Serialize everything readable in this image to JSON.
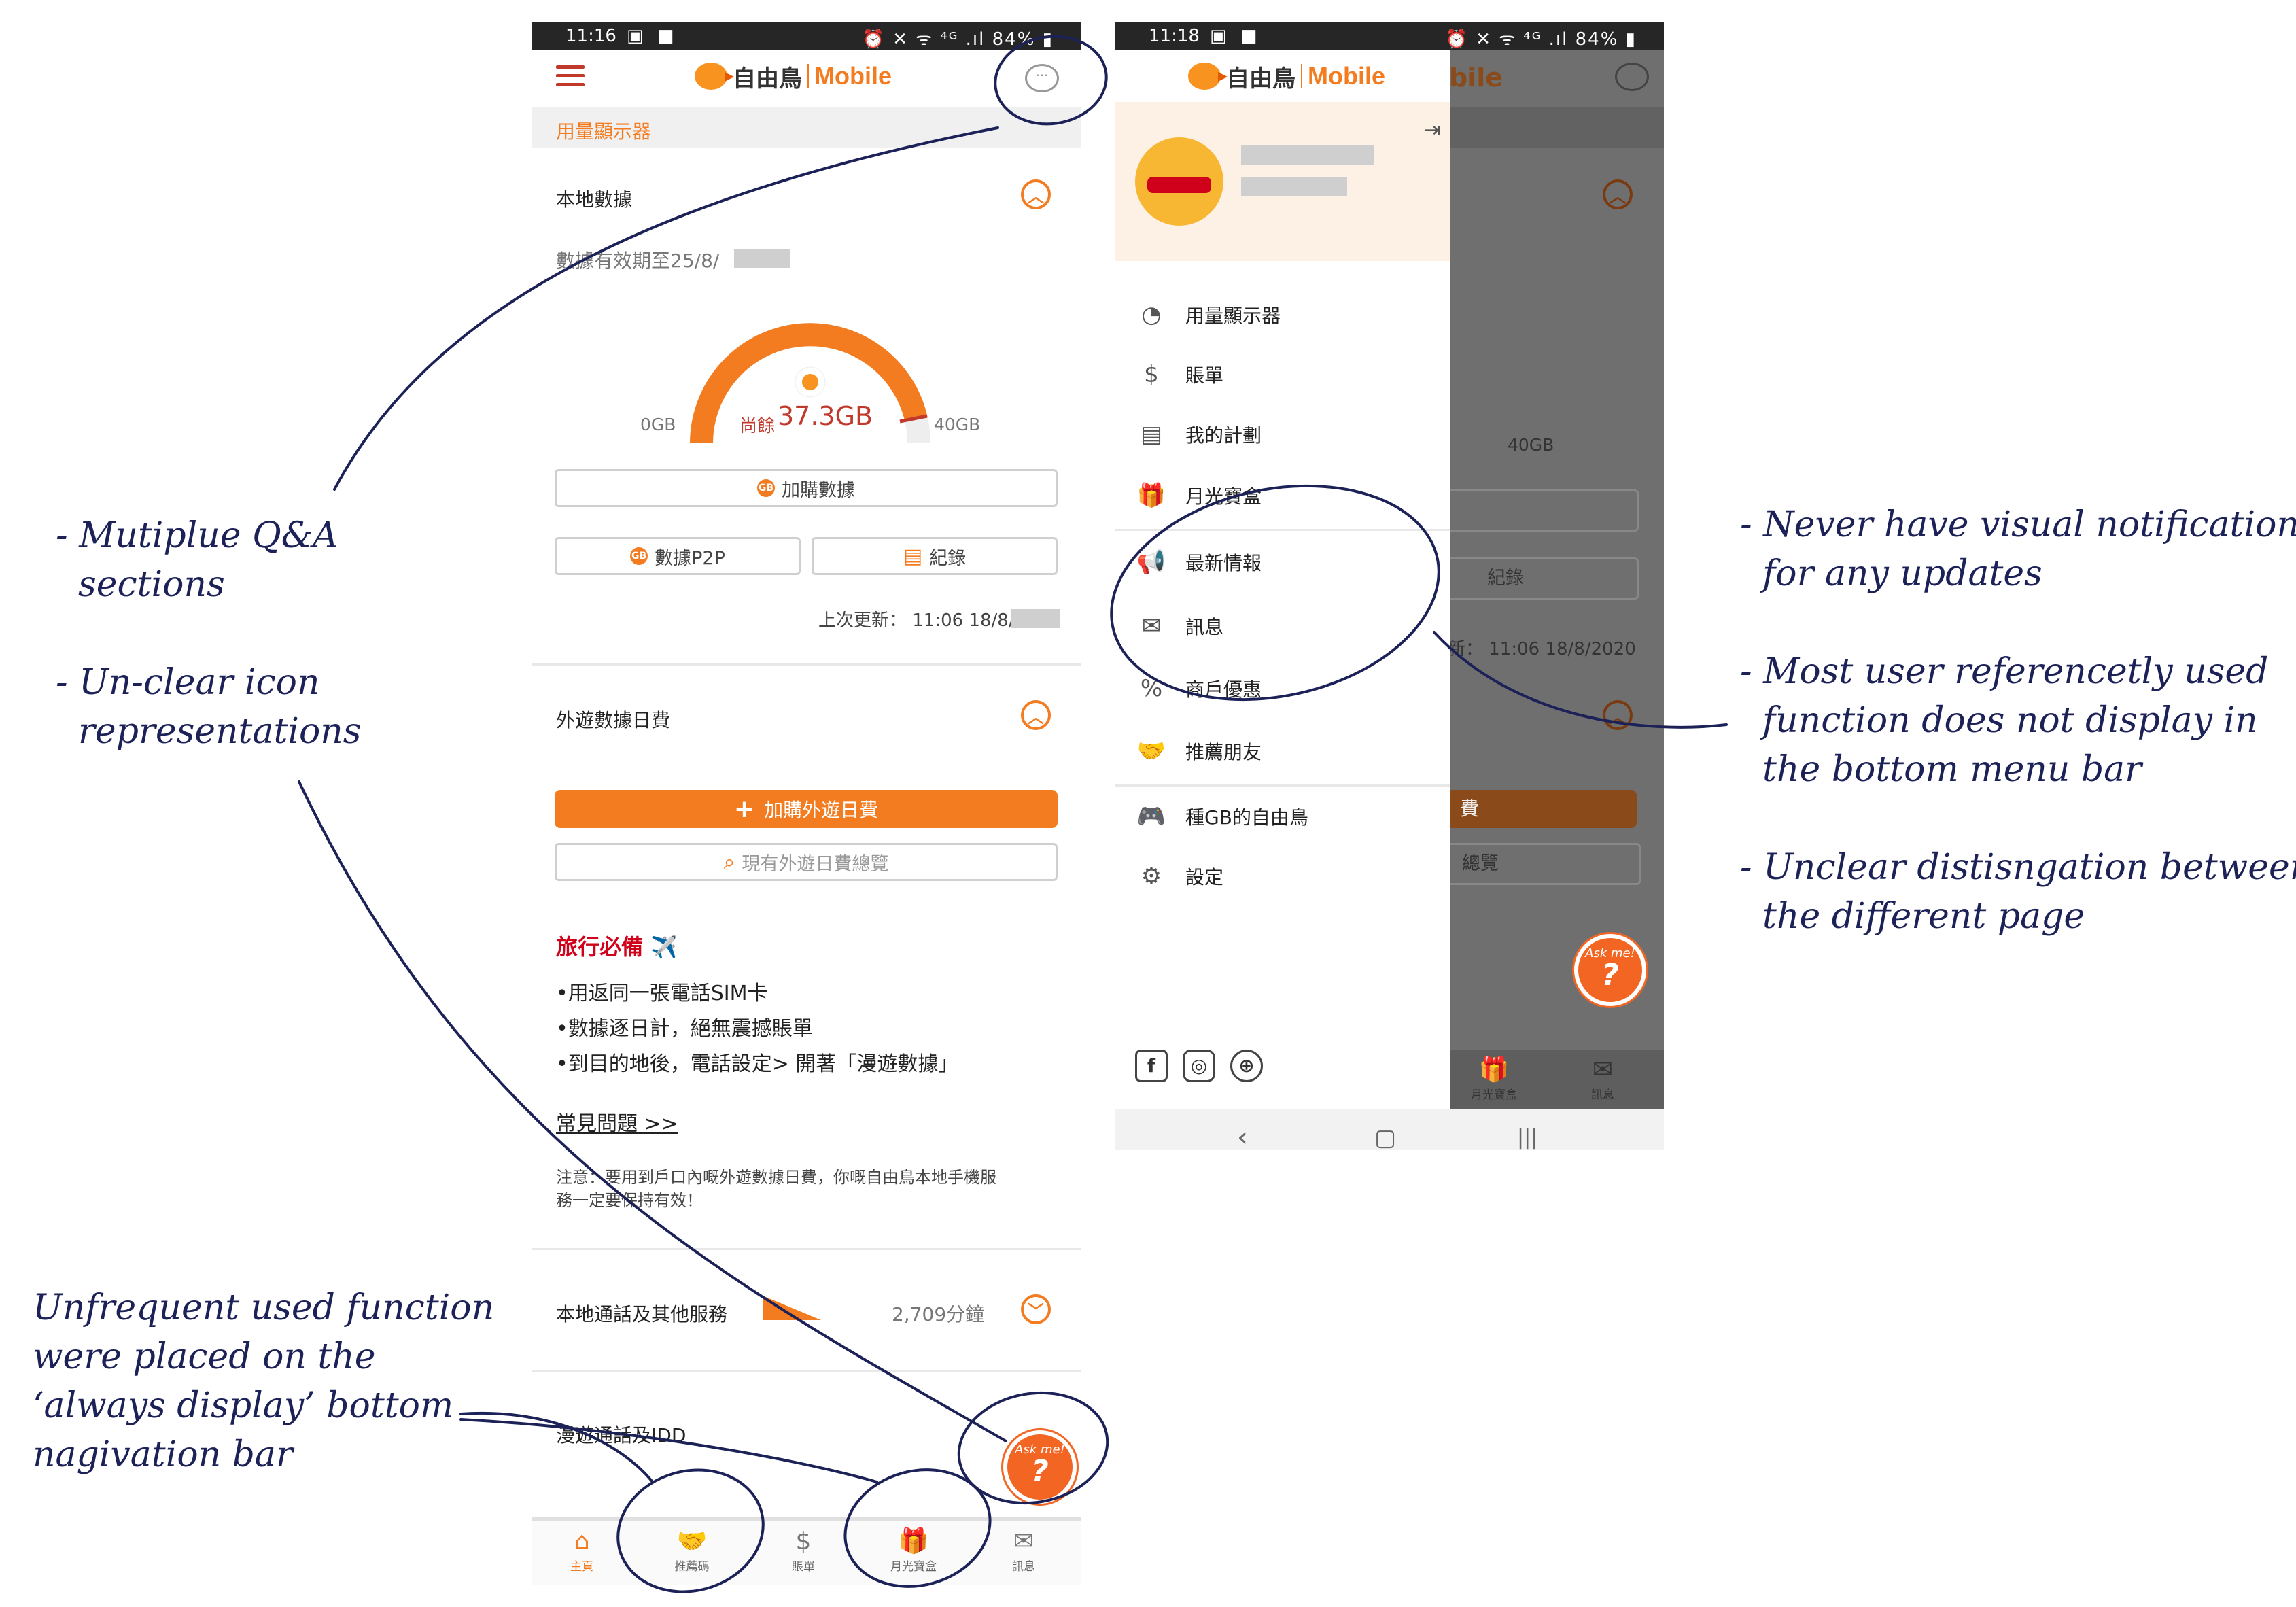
{
  "phone1": {
    "status": {
      "time": "11:16",
      "icons": "▣ ■",
      "right": "⏰ ✕ ᯤ ⁴ᴳ .ıl 84% ▮"
    },
    "logo": {
      "cn": "自由鳥",
      "en": "Mobile"
    },
    "section_title": "用量顯示器",
    "local_data": {
      "title": "本地數據",
      "validity": "數據有效期至25/8/",
      "gauge_min": "0GB",
      "gauge_max": "40GB",
      "remaining_prefix": "尚餘",
      "remaining": "37.3GB",
      "remaining_fraction": 0.93,
      "buy_data": "加購數據",
      "p2p": "數據P2P",
      "records": "紀錄",
      "last_update": "上次更新： 11:06 18/8/"
    },
    "roaming": {
      "title": "外遊數據日費",
      "add_btn": "加購外遊日費",
      "overview_btn": "現有外遊日費總覽"
    },
    "travel": {
      "title": "旅行必備 ✈️",
      "items": [
        "•用返同一張電話SIM卡",
        "•數據逐日計，絕無震撼賬單",
        "•到目的地後，電話設定> 開著「漫遊數據」"
      ],
      "faq": "常見問題 >>",
      "note_line1": "注意：要用到戶口內嘅外遊數據日費，你嘅自由鳥本地手機服",
      "note_line2": "務一定要保持有效！"
    },
    "local_calls": {
      "title": "本地通話及其他服務",
      "minutes": "2,709分鐘"
    },
    "roaming_idd": {
      "title": "漫遊通話及IDD"
    },
    "askme": {
      "top": "Ask me!",
      "mark": "?"
    },
    "nav": [
      {
        "label": "主頁",
        "icon": "⌂"
      },
      {
        "label": "推薦碼",
        "icon": "🤝"
      },
      {
        "label": "賬單",
        "icon": "$"
      },
      {
        "label": "月光寶盒",
        "icon": "🎁"
      },
      {
        "label": "訊息",
        "icon": "✉"
      }
    ]
  },
  "phone2": {
    "status": {
      "time": "11:18",
      "icons": "▣ ■",
      "right": "⏰ ✕ ᯤ ⁴ᴳ .ıl 84% ▮"
    },
    "logo": {
      "cn": "自由鳥",
      "en": "Mobile"
    },
    "bg_logo_fragment": "bile",
    "bg_last_update": "新： 11:06 18/8/2020",
    "bg_records": "紀錄",
    "bg_gauge_max": "40GB",
    "bg_button_fragment": "費",
    "bg_overview_fragment": "總覽",
    "bg_nav": [
      "月光寶盒",
      "訊息"
    ],
    "menu": [
      {
        "label": "用量顯示器",
        "icon": "◔"
      },
      {
        "label": "賬單",
        "icon": "$"
      },
      {
        "label": "我的計劃",
        "icon": "▤"
      },
      {
        "label": "月光寶盒",
        "icon": "🎁"
      },
      {
        "label": "最新情報",
        "icon": "📢"
      },
      {
        "label": "訊息",
        "icon": "✉"
      },
      {
        "label": "商戶優惠",
        "icon": "%"
      },
      {
        "label": "推薦朋友",
        "icon": "🤝"
      },
      {
        "label": "種GB的自由鳥",
        "icon": "🎮"
      },
      {
        "label": "設定",
        "icon": "⚙"
      }
    ],
    "socials": [
      "f",
      "◎",
      "⊕"
    ],
    "android_nav": [
      "‹",
      "▢",
      "|||"
    ]
  },
  "annotations": {
    "qa": "- Mutiplue Q&A\n  sections",
    "icon": "- Un-clear icon\n  representations",
    "nav": "Unfrequent used function\nwere placed on the\n‘always display’ bottom\nnagivation bar",
    "notify": "- Never have visual notification\n  for any updates",
    "function": "- Most user referencetly used\n  function does not display in\n  the bottom menu bar",
    "distinct": "- Unclear distisngation between\n  the different page"
  },
  "colors": {
    "accent": "#f47c20",
    "ink": "#1c2257",
    "alert_red": "#c0392b"
  }
}
